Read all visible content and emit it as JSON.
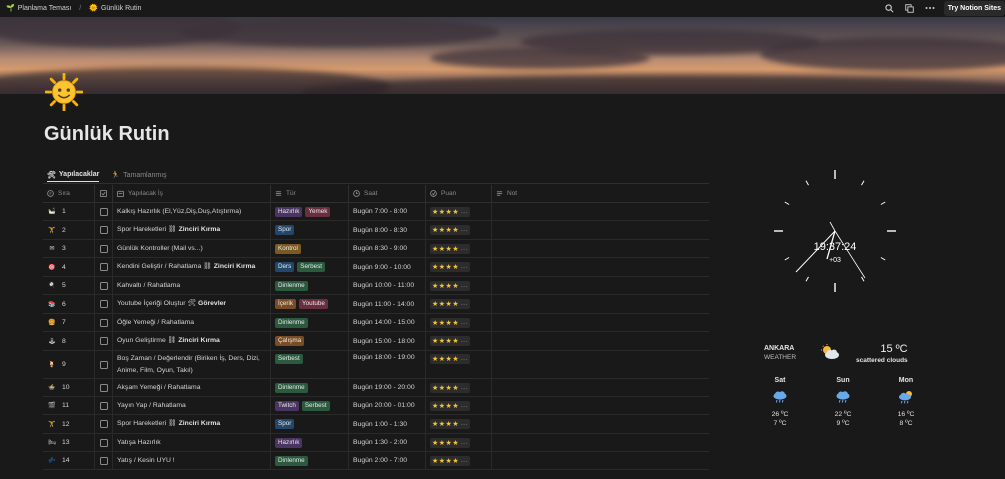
{
  "topbar": {
    "crumb1_icon": "🌱",
    "crumb1": "Planlama Teması",
    "crumb2_icon": "🌞",
    "crumb2": "Günlük Rutin",
    "try_label": "Try Notion Sites",
    "icons": [
      "search-icon",
      "duplicate-icon",
      "more-icon"
    ]
  },
  "page": {
    "emoji": "sun-with-face",
    "title": "Günlük Rutin"
  },
  "tabs": [
    {
      "label": "Yapılacaklar",
      "icon": "🛠",
      "active": true
    },
    {
      "label": "Tamamlanmış",
      "icon": "🏃",
      "active": false
    }
  ],
  "table": {
    "headers": {
      "sira": "Sıra",
      "is": "Yapılacak İş",
      "tur": "Tür",
      "saat": "Saat",
      "puan": "Puan",
      "not": "Not"
    },
    "rows": [
      {
        "icon": "🛀",
        "n": "1",
        "task": "Kalkış Hazırlık (El,Yüz,Diş,Duş,Atıştırma)",
        "link": "",
        "tags": [
          "Hazırlık",
          "Yemek"
        ],
        "time": "Bugün 7:00 - 8:00"
      },
      {
        "icon": "🏋",
        "n": "2",
        "task": "Spor Hareketleri ",
        "link": "Zinciri Kırma",
        "link_icon": "⛓",
        "tags": [
          "Spor"
        ],
        "time": "Bugün 8:00 - 8:30"
      },
      {
        "icon": "✉",
        "n": "3",
        "task": "Günlük Kontroller (Mail vs...)",
        "link": "",
        "tags": [
          "Kontrol"
        ],
        "time": "Bugün 8:30 - 9:00"
      },
      {
        "icon": "🎯",
        "n": "4",
        "task": "Kendini Geliştir / Rahatlama ",
        "link": "Zinciri Kırma",
        "link_icon": "⛓",
        "tags": [
          "Ders",
          "Serbest"
        ],
        "time": "Bugün 9:00 - 10:00"
      },
      {
        "icon": "🍳",
        "n": "5",
        "task": "Kahvaltı / Rahatlama",
        "link": "",
        "tags": [
          "Dinlenme"
        ],
        "time": "Bugün 10:00 - 11:00"
      },
      {
        "icon": "📚",
        "n": "6",
        "task": "Youtube İçeriği Oluştur ",
        "link": "Görevler",
        "link_icon": "🛠",
        "tags": [
          "İçerik",
          "Youtube"
        ],
        "time": "Bugün 11:00 - 14:00"
      },
      {
        "icon": "🍔",
        "n": "7",
        "task": "Öğle Yemeği / Rahatlama",
        "link": "",
        "tags": [
          "Dinlenme"
        ],
        "time": "Bugün 14:00 - 15:00"
      },
      {
        "icon": "🕹",
        "n": "8",
        "task": "Oyun Geliştirme ",
        "link": "Zinciri Kırma",
        "link_icon": "⛓",
        "tags": [
          "Çalışma"
        ],
        "time": "Bugün 15:00 - 18:00"
      },
      {
        "icon": "🍹",
        "n": "9",
        "task": "Boş Zaman / Değerlendir (Biriken İş, Ders, Dizi, Anime, Film, Oyun, Takıl)",
        "link": "",
        "tags": [
          "Serbest"
        ],
        "time": "Bugün 18:00 - 19:00"
      },
      {
        "icon": "🍲",
        "n": "10",
        "task": "Akşam Yemeği / Rahatlama",
        "link": "",
        "tags": [
          "Dinlenme"
        ],
        "time": "Bugün 19:00 - 20:00"
      },
      {
        "icon": "🎬",
        "n": "11",
        "task": "Yayın Yap / Rahatlama",
        "link": "",
        "tags": [
          "Twitch",
          "Serbest"
        ],
        "time": "Bugün 20:00 - 01:00"
      },
      {
        "icon": "🏋",
        "n": "12",
        "task": "Spor Hareketleri ",
        "link": "Zinciri Kırma",
        "link_icon": "⛓",
        "tags": [
          "Spor"
        ],
        "time": "Bugün 1:00 - 1:30"
      },
      {
        "icon": "🛏",
        "n": "13",
        "task": "Yatışa Hazırlık",
        "link": "",
        "tags": [
          "Hazırlık"
        ],
        "time": "Bugün 1:30 - 2:00"
      },
      {
        "icon": "💤",
        "n": "14",
        "task": "Yatış / Kesin UYU !",
        "link": "",
        "tags": [
          "Dinlenme"
        ],
        "time": "Bugün 2:00 - 7:00"
      }
    ],
    "rating_stars": 4,
    "rating_symbol": "★★★★",
    "rating_more": "..."
  },
  "tag_colors": {
    "Hazırlık": "#4a3562",
    "Yemek": "#6a2f3f",
    "Spor": "#22476a",
    "Kontrol": "#7a5a22",
    "Ders": "#22476a",
    "Serbest": "#2b5a3f",
    "Dinlenme": "#2b5a3f",
    "İçerik": "#7a4c23",
    "Youtube": "#6a2f3f",
    "Çalışma": "#7a4c23",
    "Twitch": "#4a3562"
  },
  "clock": {
    "time": "19:37:24",
    "zone": "+03"
  },
  "weather": {
    "city": "ANKARA",
    "subtitle": "WEATHER",
    "current_temp": "15 ºC",
    "current_desc": "scattered clouds",
    "current_icon": "partly-cloudy-icon",
    "days": [
      {
        "name": "Sat",
        "hi": "26 ºC",
        "lo": "7 ºC",
        "icon": "rain-cloud-icon"
      },
      {
        "name": "Sun",
        "hi": "22 ºC",
        "lo": "9 ºC",
        "icon": "rain-cloud-icon"
      },
      {
        "name": "Mon",
        "hi": "16 ºC",
        "lo": "8 ºC",
        "icon": "sun-rain-cloud-icon"
      }
    ]
  }
}
